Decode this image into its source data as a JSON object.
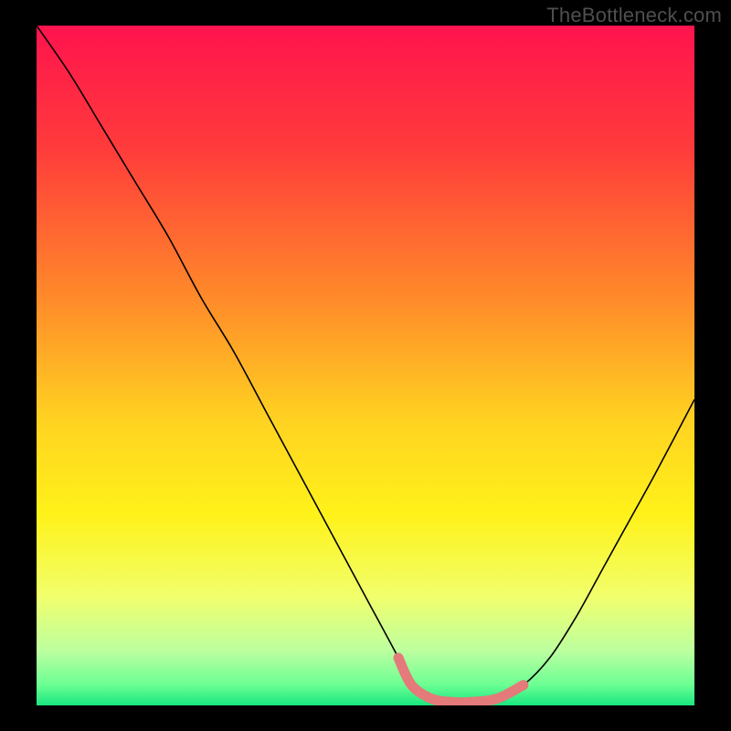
{
  "watermark": "TheBottleneck.com",
  "chart_data": {
    "type": "line",
    "title": "",
    "xlabel": "",
    "ylabel": "",
    "xlim": [
      0,
      100
    ],
    "ylim": [
      0,
      100
    ],
    "grid": false,
    "legend": false,
    "gradient_stops": [
      {
        "pct": 0,
        "color": "#ff134e"
      },
      {
        "pct": 18,
        "color": "#ff3b3b"
      },
      {
        "pct": 40,
        "color": "#ff8a2a"
      },
      {
        "pct": 58,
        "color": "#ffd221"
      },
      {
        "pct": 72,
        "color": "#fff21a"
      },
      {
        "pct": 84,
        "color": "#f1ff6c"
      },
      {
        "pct": 92,
        "color": "#bcffa0"
      },
      {
        "pct": 97,
        "color": "#6bff93"
      },
      {
        "pct": 100,
        "color": "#18e77f"
      }
    ],
    "series": [
      {
        "name": "bottleneck-curve",
        "color": "#000000",
        "x": [
          0,
          5,
          10,
          15,
          20,
          25,
          30,
          35,
          40,
          45,
          50,
          55,
          57,
          60,
          63,
          66,
          70,
          74,
          78,
          82,
          86,
          90,
          94,
          100
        ],
        "values": [
          100,
          93,
          85,
          77,
          69,
          60,
          52,
          43,
          34,
          25,
          16,
          7,
          3,
          1,
          0.5,
          0.5,
          1,
          3,
          7,
          13,
          20,
          27,
          34,
          45
        ]
      },
      {
        "name": "highlight-band",
        "color": "#e47a7a",
        "x": [
          55,
          57,
          60,
          63,
          66,
          70,
          74
        ],
        "values": [
          7,
          3,
          1,
          0.5,
          0.5,
          1,
          3
        ]
      }
    ]
  }
}
